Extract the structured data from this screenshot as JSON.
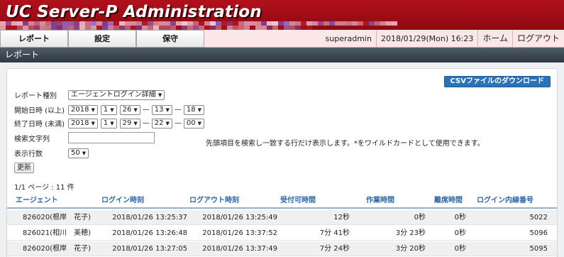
{
  "app": {
    "title": "UC Server-P Administration"
  },
  "nav": {
    "tabs": [
      "レポート",
      "設定",
      "保守"
    ],
    "user": "superadmin",
    "datetime": "2018/01/29(Mon) 16:23",
    "home": "ホーム",
    "logout": "ログアウト"
  },
  "section": {
    "title": "レポート"
  },
  "report": {
    "csv_button": "CSVファイルのダウンロード",
    "type_label": "レポート種別",
    "type_value": "エージェントログイン詳細",
    "start_label": "開始日時 (以上)",
    "start": {
      "year": "2018",
      "month": "1",
      "day": "26",
      "hour": "13",
      "minute": "18"
    },
    "end_label": "終了日時 (未満)",
    "end": {
      "year": "2018",
      "month": "1",
      "day": "29",
      "hour": "22",
      "minute": "00"
    },
    "dash": "—",
    "search_label": "検索文字列",
    "search_hint": "先頭項目を検索し一致する行だけ表示します。*をワイルドカードとして使用できます。",
    "rows_label": "表示行数",
    "rows_value": "50",
    "update_button": "更新",
    "page_info": "1/1 ページ : 11 件"
  },
  "table": {
    "columns": [
      "エージェント",
      "ログイン時刻",
      "ログアウト時刻",
      "受付可時間",
      "作業時間",
      "離席時間",
      "ログイン内線番号"
    ],
    "rows": [
      [
        "826020(根岸　花子)",
        "2018/01/26 13:25:37",
        "2018/01/26 13:25:49",
        "12秒",
        "0秒",
        "0秒",
        "5022"
      ],
      [
        "826021(相川　美穂)",
        "2018/01/26 13:26:48",
        "2018/01/26 13:37:52",
        "7分 41秒",
        "3分 23秒",
        "0秒",
        "5096"
      ],
      [
        "826020(根岸　花子)",
        "2018/01/26 13:27:05",
        "2018/01/26 13:37:49",
        "7分 24秒",
        "3分 20秒",
        "0秒",
        "5095"
      ]
    ]
  },
  "colors": {
    "banner": "#9e0c15",
    "navbar": "#fbe7e7",
    "section": "#3b4651",
    "accent": "#2b73b8",
    "header_text": "#2b66a8"
  },
  "icons": {
    "dropdown": "chevron-down-icon"
  }
}
